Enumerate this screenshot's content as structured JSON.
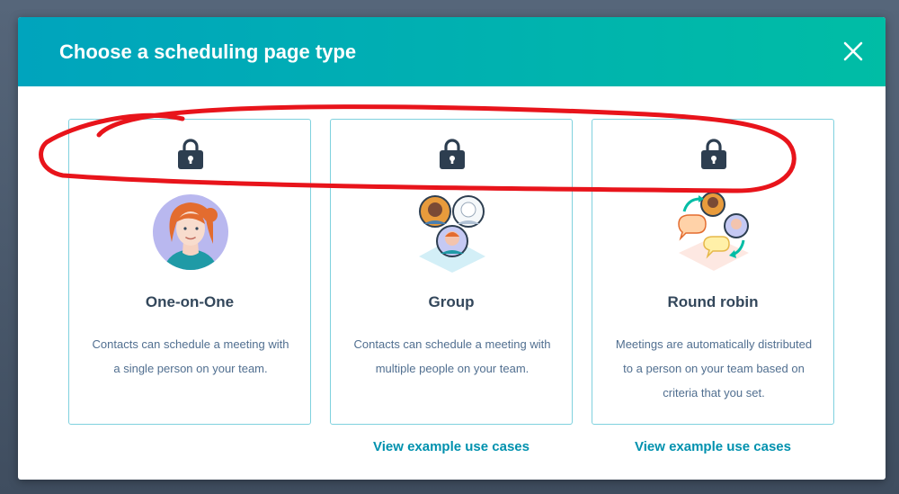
{
  "modal": {
    "title": "Choose a scheduling page type",
    "close_icon": "close-icon",
    "accent_gradient": [
      "#00a4bd",
      "#00bda5"
    ]
  },
  "cards": [
    {
      "title": "One-on-One",
      "description": "Contacts can schedule a meeting with a single person on your team.",
      "icon": "lock-icon"
    },
    {
      "title": "Group",
      "description": "Contacts can schedule a meeting with multiple people on your team.",
      "icon": "lock-icon",
      "link": "View example use cases"
    },
    {
      "title": "Round robin",
      "description": "Meetings are automatically distributed to a person on your team based on criteria that you set.",
      "icon": "lock-icon",
      "link": "View example use cases"
    }
  ],
  "annotation": {
    "color": "#e8141b"
  }
}
